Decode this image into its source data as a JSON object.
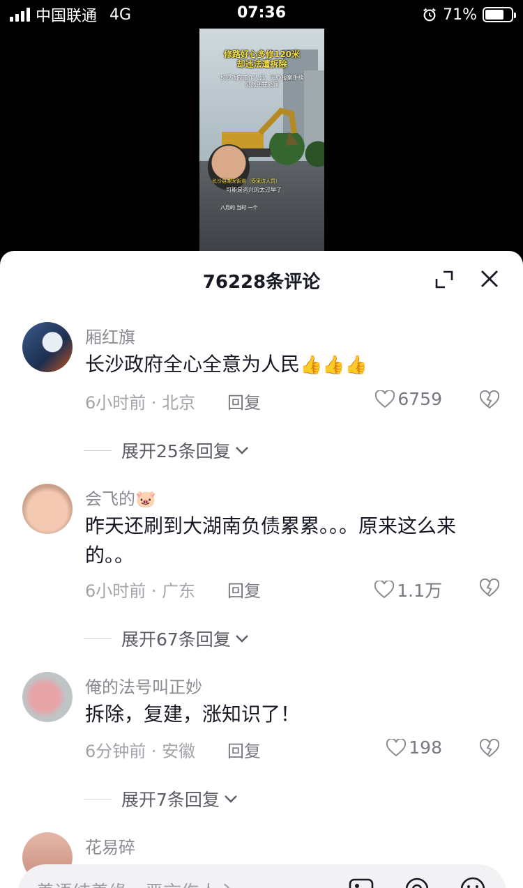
{
  "status_bar": {
    "carrier": "中国联通",
    "network": "4G",
    "time": "07:36",
    "battery_percent": "71%",
    "battery_level": 0.71
  },
  "video": {
    "title_line1": "修路好心多修120米",
    "title_line2": "却违法遭拆除",
    "subtitle_line1": "长沙政府工作人员：无办报案手续",
    "subtitle_line2": "仍然还在处理",
    "caption1": "长沙县湘龙街道（受采访人员）",
    "caption2": "可能是咨兴的太过早了",
    "caption3": "八月的 当时 一个"
  },
  "comments_sheet": {
    "title": "76228条评论",
    "comments": [
      {
        "name": "厢红旗",
        "text": "长沙政府全心全意为人民",
        "emojis": "👍👍👍",
        "meta": "6小时前 · 北京",
        "reply_label": "回复",
        "likes": "6759",
        "expand": "展开25条回复"
      },
      {
        "name": "会飞的",
        "name_emoji": "🐷",
        "text": "昨天还刷到大湖南负债累累。。。原来这么来的。。",
        "meta": "6小时前 · 广东",
        "reply_label": "回复",
        "likes": "1.1万",
        "expand": "展开67条回复"
      },
      {
        "name": "俺的法号叫正妙",
        "text": "拆除，复建，涨知识了！",
        "meta": "6分钟前 · 安徽",
        "reply_label": "回复",
        "likes": "198",
        "expand": "展开7条回复"
      },
      {
        "name": "花易碎"
      }
    ],
    "input_placeholder": "善语结善缘，恶言伤人心"
  }
}
